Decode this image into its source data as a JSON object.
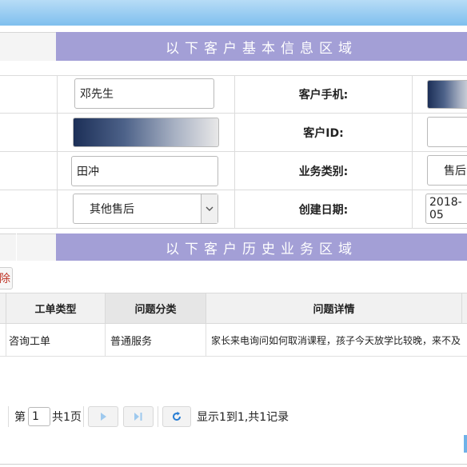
{
  "sections": {
    "customer_basic_info": "以下客户基本信息区域",
    "customer_history": "以下客户历史业务区域"
  },
  "form": {
    "contact_name": "邓先生",
    "mobile_label": "客户手机:",
    "customer_id_label": "客户ID:",
    "assignee": "田冲",
    "business_type_label": "业务类别:",
    "business_type_value": "售后",
    "category_select": "其他售后",
    "created_date_label": "创建日期:",
    "created_date_value": "2018-05"
  },
  "toolbar": {
    "delete_label": "除"
  },
  "table": {
    "headers": [
      "工单类型",
      "问题分类",
      "问题详情"
    ],
    "rows": [
      {
        "order_type": "咨询工单",
        "category": "普通服务",
        "detail": "家长来电询问如何取消课程，孩子今天放学比较晚，来不及"
      }
    ]
  },
  "pagination": {
    "page_prefix": "第",
    "page_value": "1",
    "page_suffix": "共1页",
    "summary": "显示1到1,共1记录"
  },
  "icons": {
    "next": "next-page-icon",
    "last": "last-page-icon",
    "refresh": "refresh-icon",
    "dropdown": "chevron-down-icon"
  },
  "colors": {
    "banner": "#a39fd6",
    "topbar": "#7fbfee",
    "delete_text": "#c0392b"
  }
}
